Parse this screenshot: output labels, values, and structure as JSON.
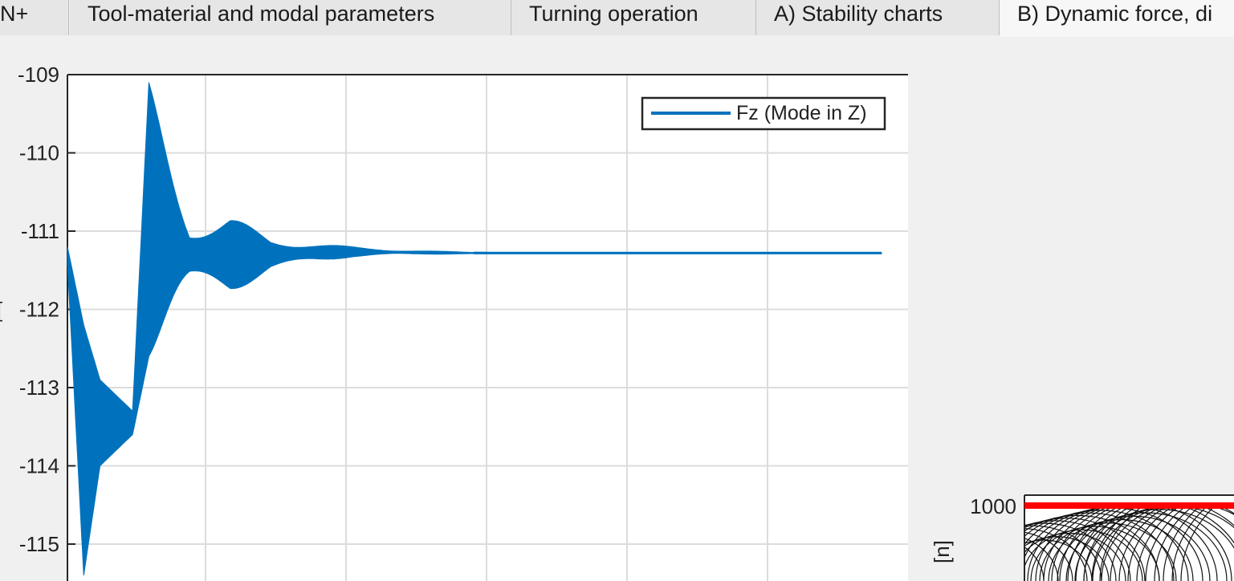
{
  "tabs": [
    {
      "label": "N+"
    },
    {
      "label": "Tool-material and modal parameters"
    },
    {
      "label": "Turning operation"
    },
    {
      "label": "A) Stability charts"
    },
    {
      "label": "B) Dynamic force, di"
    }
  ],
  "chart_data": [
    {
      "type": "line",
      "title": "",
      "xlabel": "",
      "ylabel": "",
      "ylim": [
        -115.4,
        -109
      ],
      "y_ticks": [
        "-109",
        "-110",
        "-111",
        "-112",
        "-113",
        "-114",
        "-115"
      ],
      "grid": true,
      "legend_position": "top-right",
      "series": [
        {
          "name": "Fz (Mode in Z)",
          "color": "#0072BD",
          "x": [
            0,
            0.4,
            0.8,
            1.6,
            2.0,
            3.0,
            4.0,
            5.0,
            6.0,
            7.0,
            8.0,
            10,
            12,
            14,
            16,
            18,
            20
          ],
          "upper": [
            -111.2,
            -112.2,
            -112.9,
            -113.3,
            -109.1,
            -110.9,
            -110.8,
            -111.1,
            -111.15,
            -111.2,
            -111.24,
            -111.27,
            -111.28,
            -111.28,
            -111.28,
            -111.28,
            -111.28
          ],
          "lower": [
            -111.4,
            -115.4,
            -114.0,
            -113.6,
            -112.6,
            -111.7,
            -111.8,
            -111.5,
            -111.4,
            -111.33,
            -111.3,
            -111.29,
            -111.29,
            -111.29,
            -111.29,
            -111.29,
            -111.29
          ],
          "steady_value": -111.28
        }
      ]
    },
    {
      "type": "line",
      "title": "",
      "xlabel": "",
      "ylabel": "",
      "y_ticks": [
        "1000"
      ],
      "series": [
        {
          "name": "",
          "color": "#ff0000",
          "values": [
            1000
          ]
        }
      ]
    }
  ]
}
